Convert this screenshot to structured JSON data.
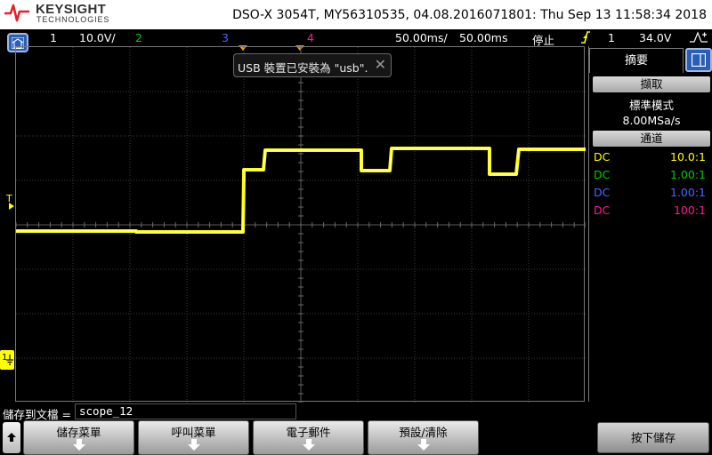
{
  "header": {
    "brand": "KEYSIGHT",
    "brand_sub": "TECHNOLOGIES",
    "device_info": "DSO-X 3054T, MY56310535, 04.08.2016071801: Thu Sep 13 11:58:34 2018"
  },
  "status": {
    "ch1_label": "1",
    "ch1_scale": "10.0V/",
    "ch2_label": "2",
    "ch3_label": "3",
    "ch4_label": "4",
    "time_scale": "50.00ms/",
    "time_delay": "50.00ms",
    "run_state": "停止",
    "trigger_source": "1",
    "trigger_level": "34.0V",
    "trigger_mode_icon": "trigger-slope-icon"
  },
  "message": {
    "text": "USB 裝置已安裝為 \"usb\".",
    "close_icon": "close-icon"
  },
  "right_panel": {
    "tab_label": "摘要",
    "acquire_header": "擷取",
    "acquire_mode": "標準模式",
    "sample_rate": "8.00MSa/s",
    "channels_header": "通道",
    "channels": [
      {
        "coupling": "DC",
        "probe": "10.0:1",
        "color": "#ffff00"
      },
      {
        "coupling": "DC",
        "probe": "1.00:1",
        "color": "#00cc00"
      },
      {
        "coupling": "DC",
        "probe": "1.00:1",
        "color": "#4a66ff"
      },
      {
        "coupling": "DC",
        "probe": "100:1",
        "color": "#ff1a8c"
      }
    ]
  },
  "markers": {
    "trigger_level_label": "T",
    "ground_label": "1"
  },
  "bottom": {
    "filename_label": "儲存到文檔 =",
    "filename_value": "scope_12",
    "softkeys": [
      "儲存菜單",
      "呼叫菜單",
      "電子郵件",
      "預設/清除"
    ],
    "press_to_save": "按下儲存"
  },
  "colors": {
    "ch1": "#ffff00",
    "ch2": "#00cc00",
    "ch3": "#4a66ff",
    "ch4": "#ff1a8c",
    "accent_blue": "#2b5fb4",
    "trigger_marker": "#f0a020"
  }
}
